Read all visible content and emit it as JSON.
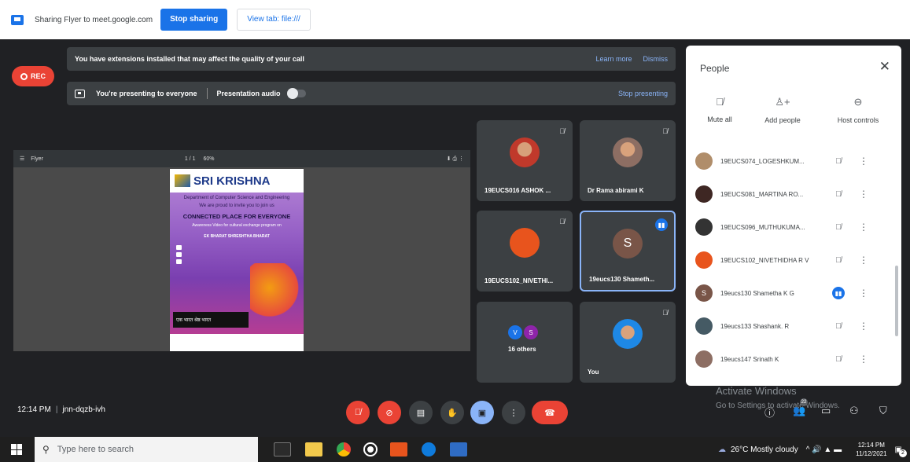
{
  "share_bar": {
    "text": "Sharing Flyer to meet.google.com",
    "stop_label": "Stop sharing",
    "view_label": "View tab: file:///"
  },
  "rec": {
    "label": "REC"
  },
  "notice": {
    "text": "You have extensions installed that may affect the quality of your call",
    "learn_more": "Learn more",
    "dismiss": "Dismiss"
  },
  "presenting": {
    "text": "You're presenting to everyone",
    "audio_label": "Presentation audio",
    "stop_label": "Stop presenting"
  },
  "pdf": {
    "title": "Flyer",
    "pages": "1 / 1",
    "zoom": "60%"
  },
  "flyer": {
    "org": "SRI KRISHNA",
    "dept": "Department of Computer Science and Engineering",
    "invite": "We are proud to invite you to join us",
    "title": "CONNECTED PLACE FOR EVERYONE",
    "subtitle": "Awareness Video for cultural exchange program on",
    "programme": "EK BHARAT SHRESHTHA BHARAT",
    "banner": "एक भारत श्रेष्ठ भारत"
  },
  "tiles": [
    {
      "name": "19EUCS016 ASHOK ...",
      "color": "#c0392b"
    },
    {
      "name": "Dr Rama abirami K",
      "color": "#8d6e63"
    },
    {
      "name": "19EUCS102_NIVETHI...",
      "color": "#e8541d",
      "initial": ""
    },
    {
      "name": "19eucs130 Shameth...",
      "color": "#795548",
      "initial": "S"
    },
    {
      "name": "16 others",
      "mini": [
        "V",
        "S"
      ]
    },
    {
      "name": "You",
      "color": "#1e88e5"
    }
  ],
  "people": {
    "title": "People",
    "controls": {
      "mute_all": "Mute all",
      "add_people": "Add people",
      "host_controls": "Host controls"
    },
    "list": [
      {
        "name": "19EUCS074_LOGESHKUM...",
        "color": "#b08d6a"
      },
      {
        "name": "19EUCS081_MARTINA RO...",
        "color": "#3e2723"
      },
      {
        "name": "19EUCS096_MUTHUKUMA...",
        "color": "#333333"
      },
      {
        "name": "19EUCS102_NIVETHIDHA R V",
        "color": "#e8541d"
      },
      {
        "name": "19eucs130 Shametha K G",
        "color": "#795548",
        "initial": "S",
        "speaking": true
      },
      {
        "name": "19eucs133 Shashank. R",
        "color": "#455a64"
      },
      {
        "name": "19eucs147 Srinath K",
        "color": "#8d6e63"
      }
    ]
  },
  "bottom": {
    "time": "12:14 PM",
    "meeting_code": "jnn-dqzb-ivh",
    "participant_count": "22"
  },
  "watermark": {
    "line1": "Activate Windows",
    "line2": "Go to Settings to activate Windows."
  },
  "taskbar": {
    "search_placeholder": "Type here to search",
    "weather": "26°C  Mostly cloudy",
    "time": "12:14 PM",
    "date": "11/12/2021",
    "notif_count": "2"
  }
}
